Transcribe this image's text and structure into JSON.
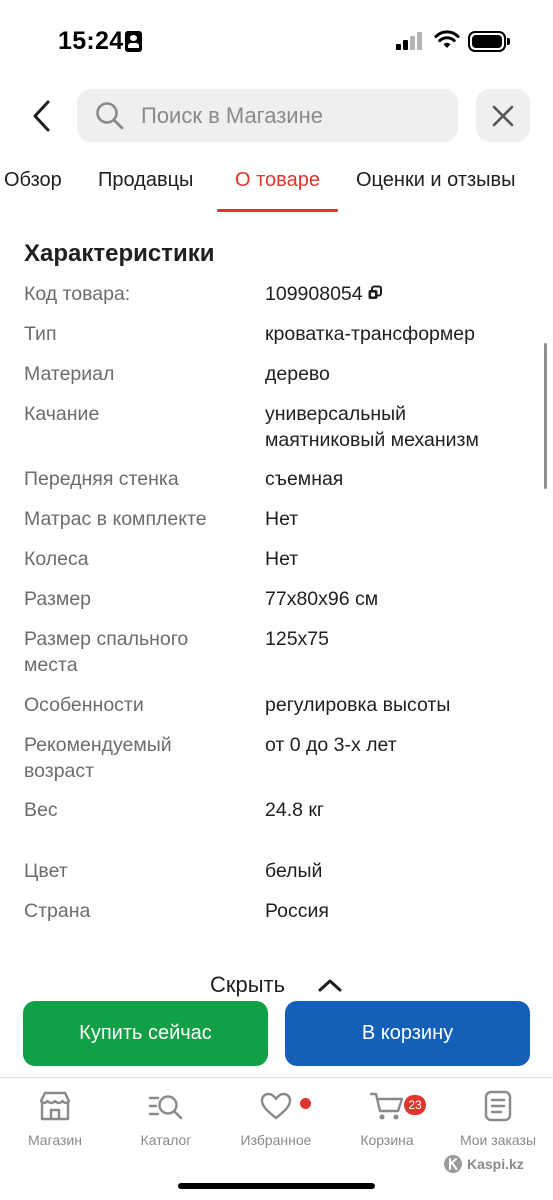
{
  "status_bar": {
    "time": "15:24"
  },
  "search": {
    "placeholder": "Поиск в Магазине"
  },
  "tabs": [
    {
      "label": "Обзор",
      "active": false
    },
    {
      "label": "Продавцы",
      "active": false
    },
    {
      "label": "О товаре",
      "active": true
    },
    {
      "label": "Оценки и отзывы",
      "active": false
    }
  ],
  "specs": {
    "title": "Характеристики",
    "rows": [
      {
        "label": "Код товара:",
        "value": "109908054"
      },
      {
        "label": "Тип",
        "value": "кроватка-трансформер"
      },
      {
        "label": "Материал",
        "value": "дерево"
      },
      {
        "label": "Качание",
        "value": "универсальный маятниковый механизм"
      },
      {
        "label": "Передняя стенка",
        "value": "съемная"
      },
      {
        "label": "Матрас в комплекте",
        "value": "Нет"
      },
      {
        "label": "Колеса",
        "value": "Нет"
      },
      {
        "label": "Размер",
        "value": "77x80x96 см"
      },
      {
        "label": "Размер спального места",
        "value": "125x75"
      },
      {
        "label": "Особенности",
        "value": "регулировка высоты"
      },
      {
        "label": "Рекомендуемый возраст",
        "value": "от 0 до 3-х лет"
      },
      {
        "label": "Вес",
        "value": "24.8 кг"
      },
      {
        "label": "Цвет",
        "value": "белый"
      },
      {
        "label": "Страна",
        "value": "Россия"
      }
    ],
    "hide_label": "Скрыть"
  },
  "actions": {
    "buy_now": "Купить сейчас",
    "add_to_cart": "В корзину"
  },
  "colors": {
    "accent_red": "#e0342c",
    "buy_green": "#12a047",
    "cart_blue": "#1460b8"
  },
  "bottom_nav": [
    {
      "label": "Магазин",
      "icon": "store-icon"
    },
    {
      "label": "Каталог",
      "icon": "catalog-search-icon"
    },
    {
      "label": "Избранное",
      "icon": "heart-icon",
      "badge_dot": true
    },
    {
      "label": "Корзина",
      "icon": "cart-icon",
      "badge": "23"
    },
    {
      "label": "Мои заказы",
      "icon": "orders-icon"
    }
  ],
  "watermark": "Kaspi.kz"
}
